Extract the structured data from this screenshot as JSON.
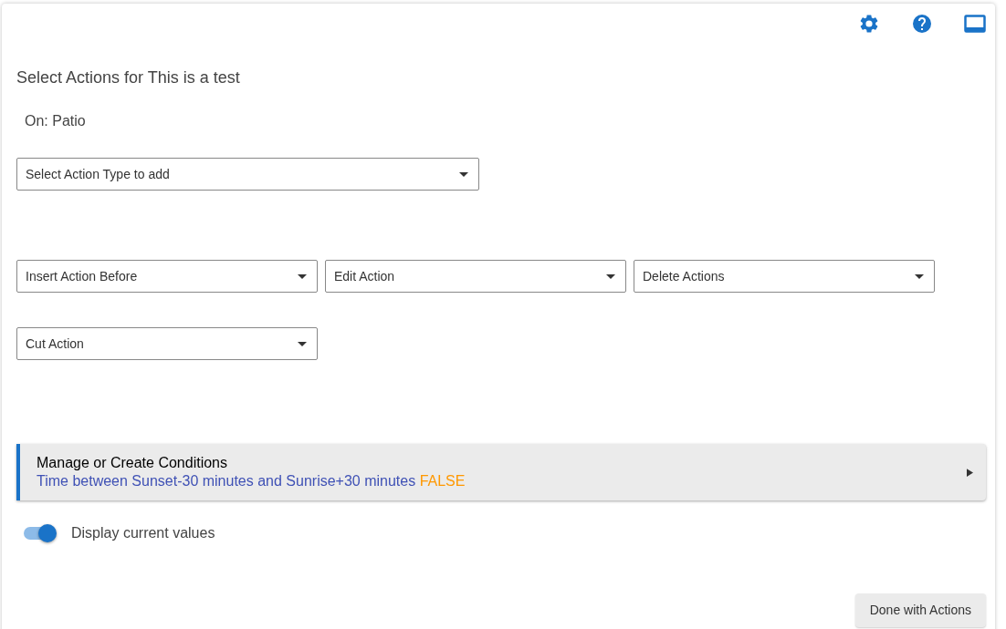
{
  "title": "Select Actions for This is a test",
  "subtitle": "On: Patio",
  "action_type_select": {
    "placeholder": "Select Action Type to add"
  },
  "action_selects": [
    {
      "placeholder": "Insert Action Before"
    },
    {
      "placeholder": "Edit Action"
    },
    {
      "placeholder": "Delete Actions"
    },
    {
      "placeholder": "Cut Action"
    }
  ],
  "conditions": {
    "title": "Manage or Create Conditions",
    "description": "Time between Sunset-30 minutes and Sunrise+30 minutes",
    "status": "FALSE",
    "expanded": false
  },
  "toggle": {
    "label": "Display current values",
    "on": true
  },
  "done_button": "Done with Actions"
}
